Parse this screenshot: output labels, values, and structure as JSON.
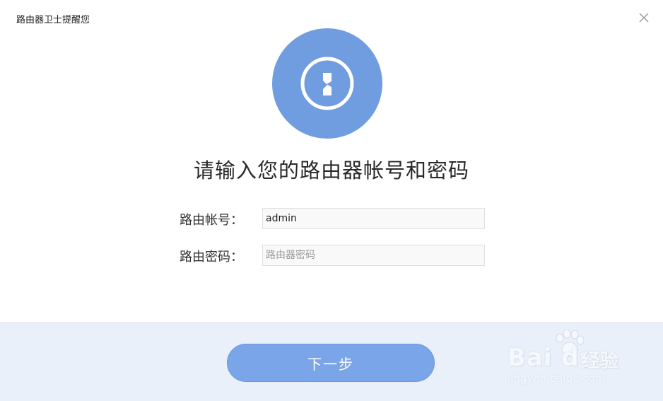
{
  "window": {
    "title": "路由器卫士提醒您"
  },
  "main": {
    "heading": "请输入您的路由器帐号和密码",
    "form": {
      "account_label": "路由帐号：",
      "account_value": "admin",
      "password_label": "路由密码：",
      "password_placeholder": "路由器密码"
    }
  },
  "footer": {
    "next_label": "下一步"
  },
  "watermark": {
    "brand": "Bai du",
    "cn": "经验",
    "url": "jingyan.baidu.com"
  },
  "colors": {
    "accent": "#6f9de0",
    "button": "#7ba5e9",
    "footer_bg": "#e9f0fa"
  },
  "icons": {
    "close": "close-icon",
    "logo": "keyhole-icon"
  }
}
